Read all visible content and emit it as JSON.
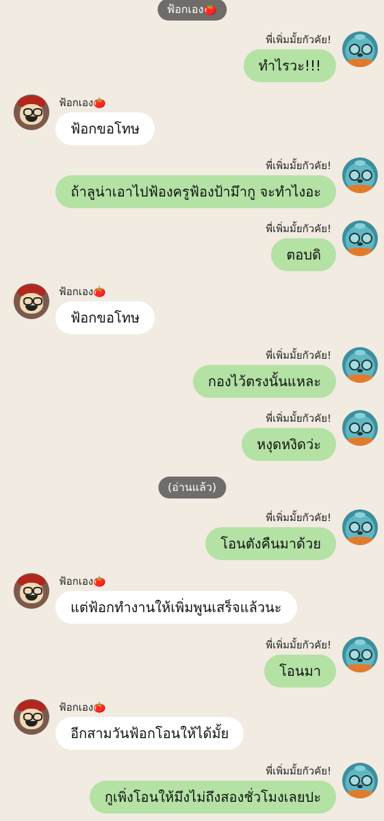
{
  "labels": {
    "top_pill": "ฟ้อกเอง🍅",
    "read_pill": "(อ่านแล้ว)"
  },
  "users": {
    "me": "พี่เพิ่มมั้ยกัวคัย!",
    "other": "ฟ้อกเอง🍅"
  },
  "messages": [
    {
      "text": "ทำไรวะ!!!"
    },
    {
      "text": "ฟ้อกขอโทษ"
    },
    {
      "text": "ถ้าลูน่าเอาไปฟ้องครูฟ้องป้ามึากู จะทำไงอะ"
    },
    {
      "text": "ตอบดิ"
    },
    {
      "text": "ฟ้อกขอโทษ"
    },
    {
      "text": "กองไว้ตรงนั้นแหละ"
    },
    {
      "text": "หงุดหงิดว่ะ"
    },
    {
      "text": "โอนตังคืนมาด้วย"
    },
    {
      "text": "แต่ฟ้อกทำงานให้เพิ่มพูนเสร็จแล้วนะ"
    },
    {
      "text": "โอนมา"
    },
    {
      "text": "อีกสามวันฟ้อกโอนให้ได้มั้ย"
    },
    {
      "text": "กูเพิ่งโอนให้มึงไม่ถึงสองชั่วโมงเลยปะ"
    }
  ]
}
